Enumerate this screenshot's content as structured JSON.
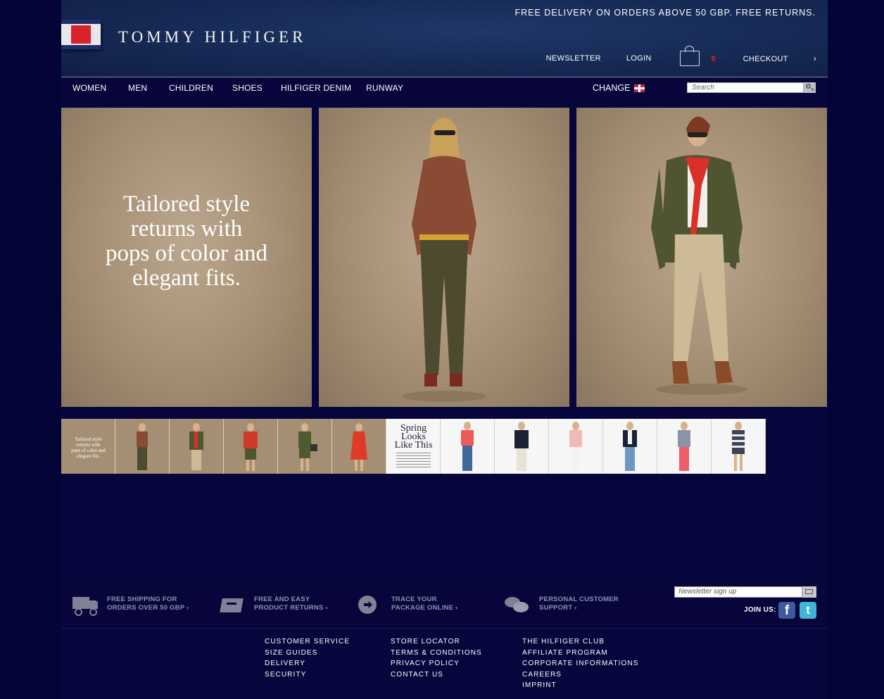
{
  "header": {
    "brand": "TOMMY HILFIGER",
    "promo": "FREE DELIVERY ON ORDERS ABOVE 50 GBP. FREE RETURNS.",
    "links": {
      "newsletter": "NEWSLETTER",
      "login": "LOGIN",
      "cart_count": "0",
      "checkout": "CHECKOUT",
      "checkout_arrow": "›"
    }
  },
  "nav": {
    "items": [
      "WOMEN",
      "MEN",
      "CHILDREN",
      "SHOES",
      "HILFIGER DENIM",
      "RUNWAY"
    ],
    "change_label": "CHANGE",
    "search_placeholder": "Search"
  },
  "hero": {
    "tagline_lines": [
      "Tailored style",
      "returns with",
      "pops of color and",
      "elegant fits."
    ]
  },
  "thumbs": {
    "first_caption_lines": [
      "Tailored style",
      "returns with",
      "pops of color and",
      "elegant fits."
    ],
    "spring_lines": [
      "Spring",
      "Looks",
      "Like This"
    ]
  },
  "features": [
    {
      "line1": "FREE SHIPPING FOR",
      "line2": "ORDERS OVER 50 GBP ›"
    },
    {
      "line1": "FREE AND EASY",
      "line2": "PRODUCT RETURNS ›"
    },
    {
      "line1": "TRACE YOUR",
      "line2": "PACKAGE ONLINE ›"
    },
    {
      "line1": "PERSONAL CUSTOMER",
      "line2": "SUPPORT ›"
    }
  ],
  "newsletter": {
    "placeholder": "Newsletter sign up",
    "join_label": "JOIN US:",
    "facebook_glyph": "f",
    "twitter_glyph": "t"
  },
  "footer_links": {
    "col1": [
      "CUSTOMER SERVICE",
      "SIZE GUIDES",
      "DELIVERY",
      "SECURITY"
    ],
    "col2": [
      "STORE LOCATOR",
      "TERMS & CONDITIONS",
      "PRIVACY POLICY",
      "CONTACT US"
    ],
    "col3": [
      "THE HILFIGER CLUB",
      "AFFILIATE PROGRAM",
      "CORPORATE INFORMATIONS",
      "CAREERS",
      "IMPRINT"
    ]
  },
  "colors": {
    "page_bg": "#06053a",
    "header_bg": "#152a57",
    "panel_tan": "#a48e73",
    "flag_red": "#d8232a"
  }
}
